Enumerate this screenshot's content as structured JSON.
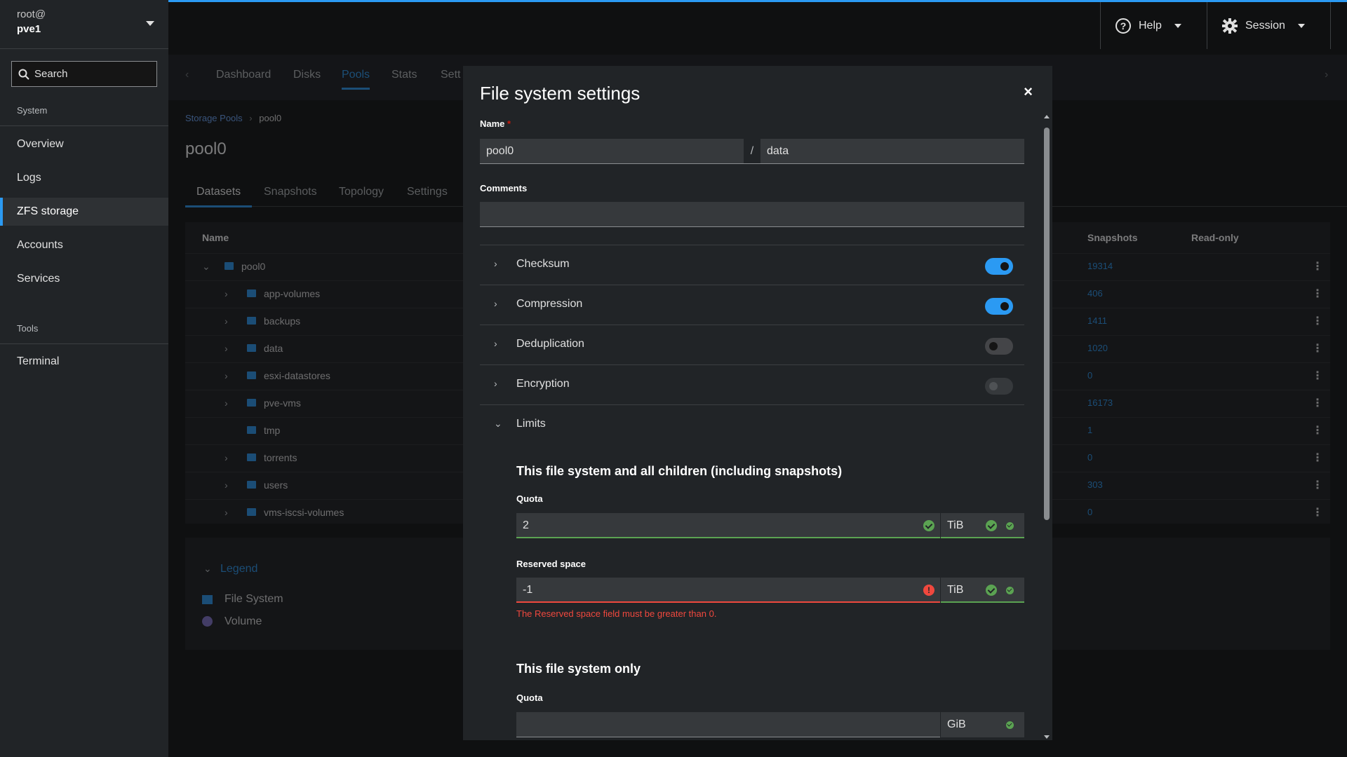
{
  "sidebar": {
    "user": "root@",
    "host": "pve1",
    "search_label": "Search",
    "section_system": "System",
    "section_tools": "Tools",
    "items": [
      {
        "label": "Overview"
      },
      {
        "label": "Logs"
      },
      {
        "label": "ZFS storage"
      },
      {
        "label": "Accounts"
      },
      {
        "label": "Services"
      },
      {
        "label": "Terminal"
      }
    ]
  },
  "header": {
    "help_label": "Help",
    "session_label": "Session"
  },
  "page_tabs": [
    "Dashboard",
    "Disks",
    "Pools",
    "Stats",
    "Sett"
  ],
  "breadcrumb": {
    "parent": "Storage Pools",
    "current": "pool0"
  },
  "page_title": "pool0",
  "sub_tabs": [
    "Datasets",
    "Snapshots",
    "Topology",
    "Settings"
  ],
  "table": {
    "col_name": "Name",
    "col_snapshots": "Snapshots",
    "col_readonly": "Read-only",
    "rows": [
      {
        "name": "pool0",
        "snapshots": "19314"
      },
      {
        "name": "app-volumes",
        "snapshots": "406"
      },
      {
        "name": "backups",
        "snapshots": "1411"
      },
      {
        "name": "data",
        "snapshots": "1020"
      },
      {
        "name": "esxi-datastores",
        "snapshots": "0"
      },
      {
        "name": "pve-vms",
        "snapshots": "16173"
      },
      {
        "name": "tmp",
        "snapshots": "1"
      },
      {
        "name": "torrents",
        "snapshots": "0"
      },
      {
        "name": "users",
        "snapshots": "303"
      },
      {
        "name": "vms-iscsi-volumes",
        "snapshots": "0"
      }
    ]
  },
  "legend": {
    "title": "Legend",
    "file_system": "File System",
    "volume": "Volume"
  },
  "modal": {
    "title": "File system settings",
    "close": "×",
    "name_label": "Name",
    "name_required": "*",
    "name_parent": "pool0",
    "name_sep": "/",
    "name_value": "data",
    "comments_label": "Comments",
    "comments_value": "",
    "sections": [
      {
        "label": "Checksum",
        "toggle": "on"
      },
      {
        "label": "Compression",
        "toggle": "on"
      },
      {
        "label": "Deduplication",
        "toggle": "off"
      },
      {
        "label": "Encryption",
        "toggle": "disabled"
      }
    ],
    "limits_label": "Limits",
    "all_children_heading": "This file system and all children (including snapshots)",
    "quota_label": "Quota",
    "quota_value": "2",
    "quota_unit": "TiB",
    "reserved_label": "Reserved space",
    "reserved_value": "-1",
    "reserved_unit": "TiB",
    "reserved_error": "The Reserved space field must be greater than 0.",
    "fs_only_heading": "This file system only",
    "fs_quota_label": "Quota",
    "fs_quota_value": "",
    "fs_quota_unit": "GiB"
  },
  "colors": {
    "accent": "#2b9af3",
    "success": "#5ba352",
    "danger": "#f0483e"
  }
}
